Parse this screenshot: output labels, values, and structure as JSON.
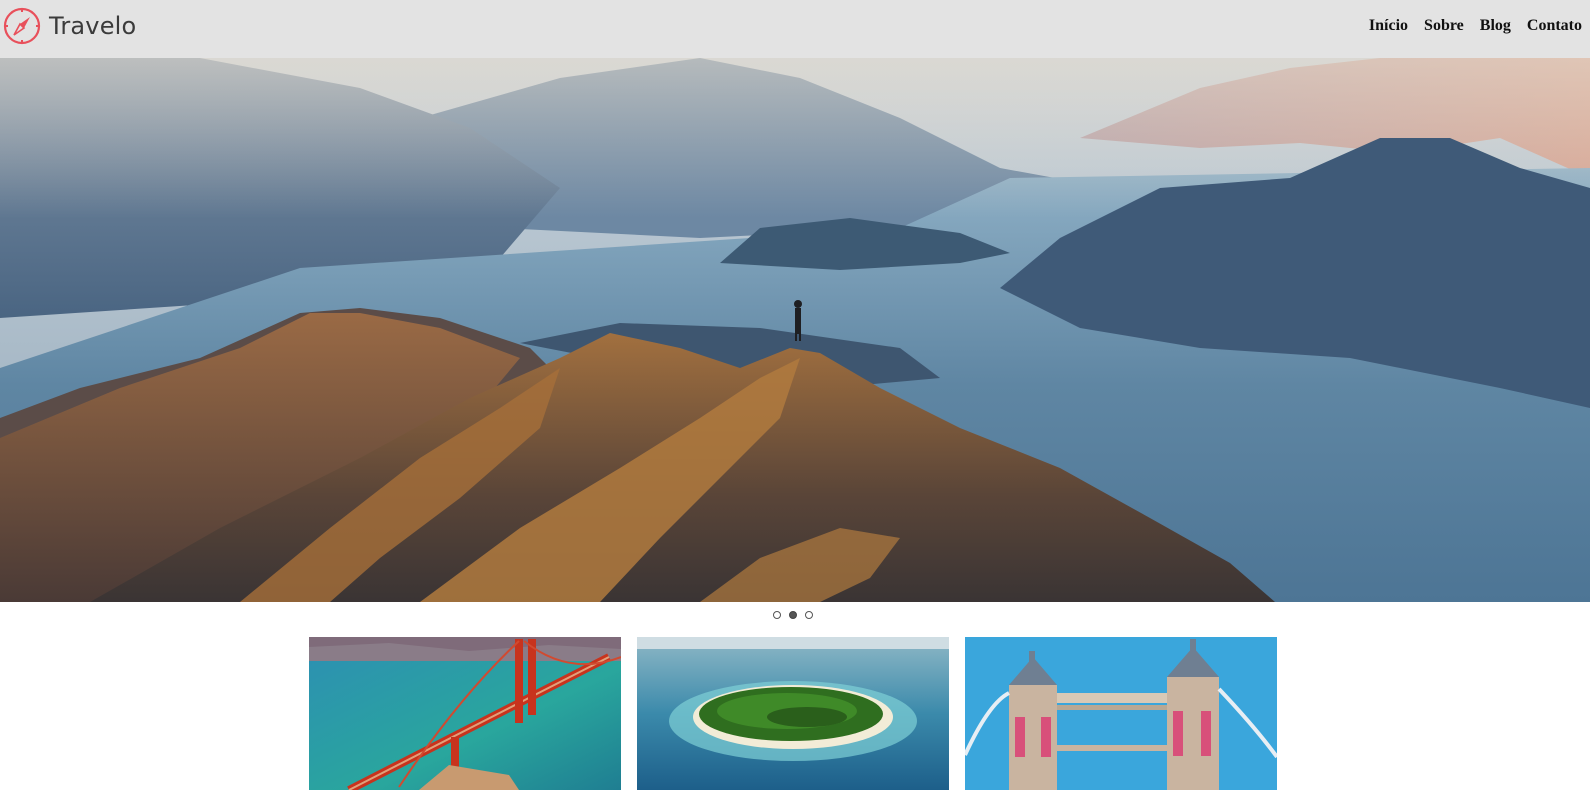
{
  "header": {
    "brand": "Travelo",
    "logo_icon": "compass-icon",
    "accent_color": "#e8505b",
    "nav": [
      {
        "label": "Início"
      },
      {
        "label": "Sobre"
      },
      {
        "label": "Blog"
      },
      {
        "label": "Contato"
      }
    ]
  },
  "hero": {
    "image": "mountain-lake-hiker-photo",
    "carousel": {
      "slide_count": 3,
      "active_index": 1
    }
  },
  "cards": [
    {
      "image": "golden-gate-bridge-photo"
    },
    {
      "image": "tropical-island-photo"
    },
    {
      "image": "tower-bridge-photo"
    }
  ]
}
